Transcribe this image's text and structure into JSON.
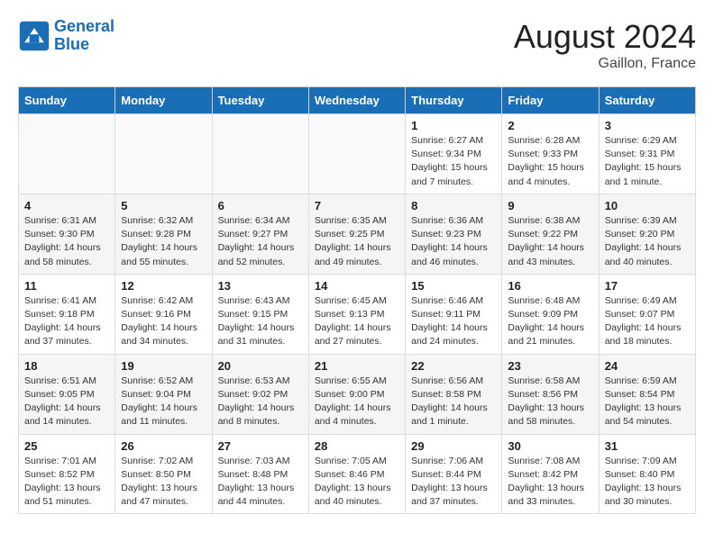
{
  "header": {
    "logo_line1": "General",
    "logo_line2": "Blue",
    "title": "August 2024",
    "subtitle": "Gaillon, France"
  },
  "days_of_week": [
    "Sunday",
    "Monday",
    "Tuesday",
    "Wednesday",
    "Thursday",
    "Friday",
    "Saturday"
  ],
  "weeks": [
    [
      {
        "day": "",
        "info": ""
      },
      {
        "day": "",
        "info": ""
      },
      {
        "day": "",
        "info": ""
      },
      {
        "day": "",
        "info": ""
      },
      {
        "day": "1",
        "info": "Sunrise: 6:27 AM\nSunset: 9:34 PM\nDaylight: 15 hours\nand 7 minutes."
      },
      {
        "day": "2",
        "info": "Sunrise: 6:28 AM\nSunset: 9:33 PM\nDaylight: 15 hours\nand 4 minutes."
      },
      {
        "day": "3",
        "info": "Sunrise: 6:29 AM\nSunset: 9:31 PM\nDaylight: 15 hours\nand 1 minute."
      }
    ],
    [
      {
        "day": "4",
        "info": "Sunrise: 6:31 AM\nSunset: 9:30 PM\nDaylight: 14 hours\nand 58 minutes."
      },
      {
        "day": "5",
        "info": "Sunrise: 6:32 AM\nSunset: 9:28 PM\nDaylight: 14 hours\nand 55 minutes."
      },
      {
        "day": "6",
        "info": "Sunrise: 6:34 AM\nSunset: 9:27 PM\nDaylight: 14 hours\nand 52 minutes."
      },
      {
        "day": "7",
        "info": "Sunrise: 6:35 AM\nSunset: 9:25 PM\nDaylight: 14 hours\nand 49 minutes."
      },
      {
        "day": "8",
        "info": "Sunrise: 6:36 AM\nSunset: 9:23 PM\nDaylight: 14 hours\nand 46 minutes."
      },
      {
        "day": "9",
        "info": "Sunrise: 6:38 AM\nSunset: 9:22 PM\nDaylight: 14 hours\nand 43 minutes."
      },
      {
        "day": "10",
        "info": "Sunrise: 6:39 AM\nSunset: 9:20 PM\nDaylight: 14 hours\nand 40 minutes."
      }
    ],
    [
      {
        "day": "11",
        "info": "Sunrise: 6:41 AM\nSunset: 9:18 PM\nDaylight: 14 hours\nand 37 minutes."
      },
      {
        "day": "12",
        "info": "Sunrise: 6:42 AM\nSunset: 9:16 PM\nDaylight: 14 hours\nand 34 minutes."
      },
      {
        "day": "13",
        "info": "Sunrise: 6:43 AM\nSunset: 9:15 PM\nDaylight: 14 hours\nand 31 minutes."
      },
      {
        "day": "14",
        "info": "Sunrise: 6:45 AM\nSunset: 9:13 PM\nDaylight: 14 hours\nand 27 minutes."
      },
      {
        "day": "15",
        "info": "Sunrise: 6:46 AM\nSunset: 9:11 PM\nDaylight: 14 hours\nand 24 minutes."
      },
      {
        "day": "16",
        "info": "Sunrise: 6:48 AM\nSunset: 9:09 PM\nDaylight: 14 hours\nand 21 minutes."
      },
      {
        "day": "17",
        "info": "Sunrise: 6:49 AM\nSunset: 9:07 PM\nDaylight: 14 hours\nand 18 minutes."
      }
    ],
    [
      {
        "day": "18",
        "info": "Sunrise: 6:51 AM\nSunset: 9:05 PM\nDaylight: 14 hours\nand 14 minutes."
      },
      {
        "day": "19",
        "info": "Sunrise: 6:52 AM\nSunset: 9:04 PM\nDaylight: 14 hours\nand 11 minutes."
      },
      {
        "day": "20",
        "info": "Sunrise: 6:53 AM\nSunset: 9:02 PM\nDaylight: 14 hours\nand 8 minutes."
      },
      {
        "day": "21",
        "info": "Sunrise: 6:55 AM\nSunset: 9:00 PM\nDaylight: 14 hours\nand 4 minutes."
      },
      {
        "day": "22",
        "info": "Sunrise: 6:56 AM\nSunset: 8:58 PM\nDaylight: 14 hours\nand 1 minute."
      },
      {
        "day": "23",
        "info": "Sunrise: 6:58 AM\nSunset: 8:56 PM\nDaylight: 13 hours\nand 58 minutes."
      },
      {
        "day": "24",
        "info": "Sunrise: 6:59 AM\nSunset: 8:54 PM\nDaylight: 13 hours\nand 54 minutes."
      }
    ],
    [
      {
        "day": "25",
        "info": "Sunrise: 7:01 AM\nSunset: 8:52 PM\nDaylight: 13 hours\nand 51 minutes."
      },
      {
        "day": "26",
        "info": "Sunrise: 7:02 AM\nSunset: 8:50 PM\nDaylight: 13 hours\nand 47 minutes."
      },
      {
        "day": "27",
        "info": "Sunrise: 7:03 AM\nSunset: 8:48 PM\nDaylight: 13 hours\nand 44 minutes."
      },
      {
        "day": "28",
        "info": "Sunrise: 7:05 AM\nSunset: 8:46 PM\nDaylight: 13 hours\nand 40 minutes."
      },
      {
        "day": "29",
        "info": "Sunrise: 7:06 AM\nSunset: 8:44 PM\nDaylight: 13 hours\nand 37 minutes."
      },
      {
        "day": "30",
        "info": "Sunrise: 7:08 AM\nSunset: 8:42 PM\nDaylight: 13 hours\nand 33 minutes."
      },
      {
        "day": "31",
        "info": "Sunrise: 7:09 AM\nSunset: 8:40 PM\nDaylight: 13 hours\nand 30 minutes."
      }
    ]
  ]
}
